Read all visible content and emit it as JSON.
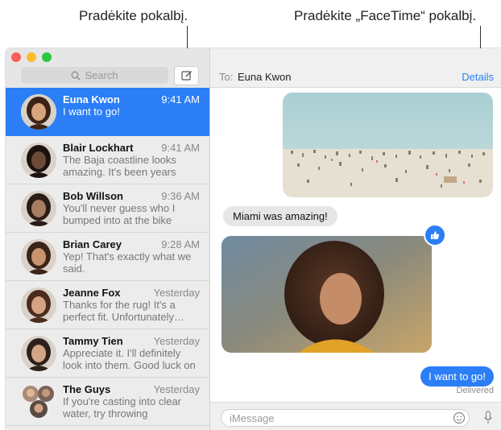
{
  "callouts": {
    "left": "Pradėkite pokalbį.",
    "right": "Pradėkite „FaceTime“ pokalbį."
  },
  "colors": {
    "accent": "#2b7ef6",
    "traffic_close": "#fc5d57",
    "traffic_min": "#fdbc2e",
    "traffic_max": "#28c840"
  },
  "sidebar": {
    "search_placeholder": "Search",
    "compose_icon": "compose-icon",
    "conversations": [
      {
        "name": "Euna Kwon",
        "time": "9:41 AM",
        "preview": "I want to go!",
        "selected": true
      },
      {
        "name": "Blair Lockhart",
        "time": "9:41 AM",
        "preview": "The Baja coastline looks amazing. It's been years since…"
      },
      {
        "name": "Bob Willson",
        "time": "9:36 AM",
        "preview": "You'll never guess who I bumped into at the bike shop…"
      },
      {
        "name": "Brian Carey",
        "time": "9:28 AM",
        "preview": "Yep! That's exactly what we said."
      },
      {
        "name": "Jeanne Fox",
        "time": "Yesterday",
        "preview": "Thanks for the rug! It's a perfect fit. Unfortunately…"
      },
      {
        "name": "Tammy Tien",
        "time": "Yesterday",
        "preview": "Appreciate it. I'll definitely look into them. Good luck on the…"
      },
      {
        "name": "The Guys",
        "time": "Yesterday",
        "preview": "If you're casting into clear water, try throwing something…"
      }
    ]
  },
  "chat": {
    "to_label": "To:",
    "recipient": "Euna Kwon",
    "details_label": "Details",
    "messages": {
      "received_text": "Miami was amazing!",
      "sent_text": "I want to go!",
      "status": "Delivered"
    },
    "composer_placeholder": "iMessage",
    "tapback_icon": "thumbs-up-icon"
  }
}
